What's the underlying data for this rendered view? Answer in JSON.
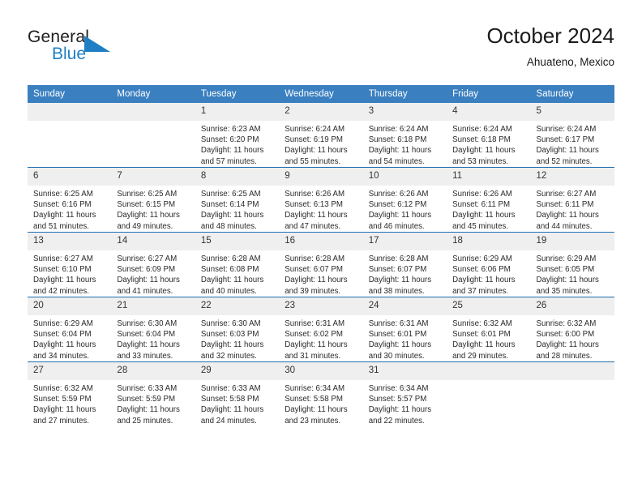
{
  "brand": {
    "name_part1": "General",
    "name_part2": "Blue",
    "flag_color": "#1f7fc4"
  },
  "header": {
    "title": "October 2024",
    "subtitle": "Ahuateno, Mexico"
  },
  "theme": {
    "header_bg": "#3a7fc0",
    "row_divider": "#1f6fb2",
    "daynum_bg": "#efefef"
  },
  "weekday_headers": [
    "Sunday",
    "Monday",
    "Tuesday",
    "Wednesday",
    "Thursday",
    "Friday",
    "Saturday"
  ],
  "weeks": [
    [
      {
        "day": "",
        "empty": true,
        "sunrise": "",
        "sunset": "",
        "daylight_line1": "",
        "daylight_line2": ""
      },
      {
        "day": "",
        "empty": true,
        "sunrise": "",
        "sunset": "",
        "daylight_line1": "",
        "daylight_line2": ""
      },
      {
        "day": "1",
        "sunrise": "Sunrise: 6:23 AM",
        "sunset": "Sunset: 6:20 PM",
        "daylight_line1": "Daylight: 11 hours",
        "daylight_line2": "and 57 minutes."
      },
      {
        "day": "2",
        "sunrise": "Sunrise: 6:24 AM",
        "sunset": "Sunset: 6:19 PM",
        "daylight_line1": "Daylight: 11 hours",
        "daylight_line2": "and 55 minutes."
      },
      {
        "day": "3",
        "sunrise": "Sunrise: 6:24 AM",
        "sunset": "Sunset: 6:18 PM",
        "daylight_line1": "Daylight: 11 hours",
        "daylight_line2": "and 54 minutes."
      },
      {
        "day": "4",
        "sunrise": "Sunrise: 6:24 AM",
        "sunset": "Sunset: 6:18 PM",
        "daylight_line1": "Daylight: 11 hours",
        "daylight_line2": "and 53 minutes."
      },
      {
        "day": "5",
        "sunrise": "Sunrise: 6:24 AM",
        "sunset": "Sunset: 6:17 PM",
        "daylight_line1": "Daylight: 11 hours",
        "daylight_line2": "and 52 minutes."
      }
    ],
    [
      {
        "day": "6",
        "sunrise": "Sunrise: 6:25 AM",
        "sunset": "Sunset: 6:16 PM",
        "daylight_line1": "Daylight: 11 hours",
        "daylight_line2": "and 51 minutes."
      },
      {
        "day": "7",
        "sunrise": "Sunrise: 6:25 AM",
        "sunset": "Sunset: 6:15 PM",
        "daylight_line1": "Daylight: 11 hours",
        "daylight_line2": "and 49 minutes."
      },
      {
        "day": "8",
        "sunrise": "Sunrise: 6:25 AM",
        "sunset": "Sunset: 6:14 PM",
        "daylight_line1": "Daylight: 11 hours",
        "daylight_line2": "and 48 minutes."
      },
      {
        "day": "9",
        "sunrise": "Sunrise: 6:26 AM",
        "sunset": "Sunset: 6:13 PM",
        "daylight_line1": "Daylight: 11 hours",
        "daylight_line2": "and 47 minutes."
      },
      {
        "day": "10",
        "sunrise": "Sunrise: 6:26 AM",
        "sunset": "Sunset: 6:12 PM",
        "daylight_line1": "Daylight: 11 hours",
        "daylight_line2": "and 46 minutes."
      },
      {
        "day": "11",
        "sunrise": "Sunrise: 6:26 AM",
        "sunset": "Sunset: 6:11 PM",
        "daylight_line1": "Daylight: 11 hours",
        "daylight_line2": "and 45 minutes."
      },
      {
        "day": "12",
        "sunrise": "Sunrise: 6:27 AM",
        "sunset": "Sunset: 6:11 PM",
        "daylight_line1": "Daylight: 11 hours",
        "daylight_line2": "and 44 minutes."
      }
    ],
    [
      {
        "day": "13",
        "sunrise": "Sunrise: 6:27 AM",
        "sunset": "Sunset: 6:10 PM",
        "daylight_line1": "Daylight: 11 hours",
        "daylight_line2": "and 42 minutes."
      },
      {
        "day": "14",
        "sunrise": "Sunrise: 6:27 AM",
        "sunset": "Sunset: 6:09 PM",
        "daylight_line1": "Daylight: 11 hours",
        "daylight_line2": "and 41 minutes."
      },
      {
        "day": "15",
        "sunrise": "Sunrise: 6:28 AM",
        "sunset": "Sunset: 6:08 PM",
        "daylight_line1": "Daylight: 11 hours",
        "daylight_line2": "and 40 minutes."
      },
      {
        "day": "16",
        "sunrise": "Sunrise: 6:28 AM",
        "sunset": "Sunset: 6:07 PM",
        "daylight_line1": "Daylight: 11 hours",
        "daylight_line2": "and 39 minutes."
      },
      {
        "day": "17",
        "sunrise": "Sunrise: 6:28 AM",
        "sunset": "Sunset: 6:07 PM",
        "daylight_line1": "Daylight: 11 hours",
        "daylight_line2": "and 38 minutes."
      },
      {
        "day": "18",
        "sunrise": "Sunrise: 6:29 AM",
        "sunset": "Sunset: 6:06 PM",
        "daylight_line1": "Daylight: 11 hours",
        "daylight_line2": "and 37 minutes."
      },
      {
        "day": "19",
        "sunrise": "Sunrise: 6:29 AM",
        "sunset": "Sunset: 6:05 PM",
        "daylight_line1": "Daylight: 11 hours",
        "daylight_line2": "and 35 minutes."
      }
    ],
    [
      {
        "day": "20",
        "sunrise": "Sunrise: 6:29 AM",
        "sunset": "Sunset: 6:04 PM",
        "daylight_line1": "Daylight: 11 hours",
        "daylight_line2": "and 34 minutes."
      },
      {
        "day": "21",
        "sunrise": "Sunrise: 6:30 AM",
        "sunset": "Sunset: 6:04 PM",
        "daylight_line1": "Daylight: 11 hours",
        "daylight_line2": "and 33 minutes."
      },
      {
        "day": "22",
        "sunrise": "Sunrise: 6:30 AM",
        "sunset": "Sunset: 6:03 PM",
        "daylight_line1": "Daylight: 11 hours",
        "daylight_line2": "and 32 minutes."
      },
      {
        "day": "23",
        "sunrise": "Sunrise: 6:31 AM",
        "sunset": "Sunset: 6:02 PM",
        "daylight_line1": "Daylight: 11 hours",
        "daylight_line2": "and 31 minutes."
      },
      {
        "day": "24",
        "sunrise": "Sunrise: 6:31 AM",
        "sunset": "Sunset: 6:01 PM",
        "daylight_line1": "Daylight: 11 hours",
        "daylight_line2": "and 30 minutes."
      },
      {
        "day": "25",
        "sunrise": "Sunrise: 6:32 AM",
        "sunset": "Sunset: 6:01 PM",
        "daylight_line1": "Daylight: 11 hours",
        "daylight_line2": "and 29 minutes."
      },
      {
        "day": "26",
        "sunrise": "Sunrise: 6:32 AM",
        "sunset": "Sunset: 6:00 PM",
        "daylight_line1": "Daylight: 11 hours",
        "daylight_line2": "and 28 minutes."
      }
    ],
    [
      {
        "day": "27",
        "sunrise": "Sunrise: 6:32 AM",
        "sunset": "Sunset: 5:59 PM",
        "daylight_line1": "Daylight: 11 hours",
        "daylight_line2": "and 27 minutes."
      },
      {
        "day": "28",
        "sunrise": "Sunrise: 6:33 AM",
        "sunset": "Sunset: 5:59 PM",
        "daylight_line1": "Daylight: 11 hours",
        "daylight_line2": "and 25 minutes."
      },
      {
        "day": "29",
        "sunrise": "Sunrise: 6:33 AM",
        "sunset": "Sunset: 5:58 PM",
        "daylight_line1": "Daylight: 11 hours",
        "daylight_line2": "and 24 minutes."
      },
      {
        "day": "30",
        "sunrise": "Sunrise: 6:34 AM",
        "sunset": "Sunset: 5:58 PM",
        "daylight_line1": "Daylight: 11 hours",
        "daylight_line2": "and 23 minutes."
      },
      {
        "day": "31",
        "sunrise": "Sunrise: 6:34 AM",
        "sunset": "Sunset: 5:57 PM",
        "daylight_line1": "Daylight: 11 hours",
        "daylight_line2": "and 22 minutes."
      },
      {
        "day": "",
        "empty": true,
        "sunrise": "",
        "sunset": "",
        "daylight_line1": "",
        "daylight_line2": ""
      },
      {
        "day": "",
        "empty": true,
        "sunrise": "",
        "sunset": "",
        "daylight_line1": "",
        "daylight_line2": ""
      }
    ]
  ]
}
